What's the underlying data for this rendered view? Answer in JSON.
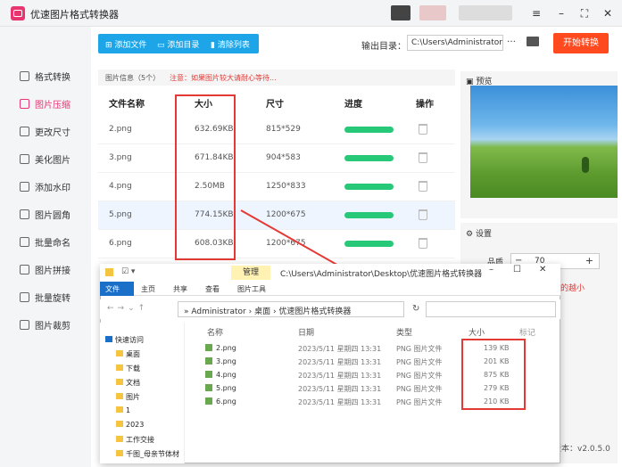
{
  "app": {
    "title": "优速图片格式转换器",
    "version": "版本：v2.0.5.0"
  },
  "sidebar": {
    "items": [
      {
        "label": "格式转换",
        "active": false
      },
      {
        "label": "图片压缩",
        "active": true
      },
      {
        "label": "更改尺寸",
        "active": false
      },
      {
        "label": "美化图片",
        "active": false
      },
      {
        "label": "添加水印",
        "active": false
      },
      {
        "label": "图片圆角",
        "active": false
      },
      {
        "label": "批量命名",
        "active": false
      },
      {
        "label": "图片拼接",
        "active": false
      },
      {
        "label": "批量旋转",
        "active": false
      },
      {
        "label": "图片裁剪",
        "active": false
      }
    ]
  },
  "toolbar": {
    "add_file": "添加文件",
    "add_dir": "添加目录",
    "clear": "清除列表"
  },
  "output": {
    "label": "输出目录：",
    "path": "C:\\Users\\Administrator\\",
    "dots": "…",
    "start": "开始转换"
  },
  "info": {
    "label": "图片信息（5个）",
    "warning": "注意：如果图片较大请耐心等待..."
  },
  "table": {
    "headers": [
      "文件名称",
      "大小",
      "尺寸",
      "进度",
      "操作"
    ],
    "rows": [
      {
        "name": "2.png",
        "size": "632.69KB",
        "dim": "815*529"
      },
      {
        "name": "3.png",
        "size": "671.84KB",
        "dim": "904*583"
      },
      {
        "name": "4.png",
        "size": "2.50MB",
        "dim": "1250*833"
      },
      {
        "name": "5.png",
        "size": "774.15KB",
        "dim": "1200*675"
      },
      {
        "name": "6.png",
        "size": "608.03KB",
        "dim": "1200*675"
      }
    ]
  },
  "preview": {
    "label": "预览"
  },
  "settings": {
    "label": "设置",
    "quality_label": "品质",
    "quality_value": "70",
    "hint": "的越小"
  },
  "explorer": {
    "path_title": "C:\\Users\\Administrator\\Desktop\\优速图片格式转换器",
    "manage": "管理",
    "ribbon": [
      "文件",
      "主页",
      "共享",
      "查看",
      "图片工具"
    ],
    "breadcrumb": [
      "Administrator",
      "桌面",
      "优速图片格式转换器"
    ],
    "nav": [
      "快速访问",
      "桌面",
      "下载",
      "文档",
      "图片",
      "1",
      "2023",
      "工作交接",
      "千图_母亲节体材"
    ],
    "columns": [
      "名称",
      "日期",
      "类型",
      "大小",
      "标记"
    ],
    "files": [
      {
        "name": "2.png",
        "date": "2023/5/11 星期四 13:31",
        "type": "PNG 图片文件",
        "size": "139 KB"
      },
      {
        "name": "3.png",
        "date": "2023/5/11 星期四 13:31",
        "type": "PNG 图片文件",
        "size": "201 KB"
      },
      {
        "name": "4.png",
        "date": "2023/5/11 星期四 13:31",
        "type": "PNG 图片文件",
        "size": "875 KB"
      },
      {
        "name": "5.png",
        "date": "2023/5/11 星期四 13:31",
        "type": "PNG 图片文件",
        "size": "279 KB"
      },
      {
        "name": "6.png",
        "date": "2023/5/11 星期四 13:31",
        "type": "PNG 图片文件",
        "size": "210 KB"
      }
    ]
  },
  "colors": {
    "accent": "#e8356f",
    "toolbar": "#1da5e8",
    "start": "#ff4a1f",
    "progress": "#28c879",
    "highlight": "#e53935"
  }
}
